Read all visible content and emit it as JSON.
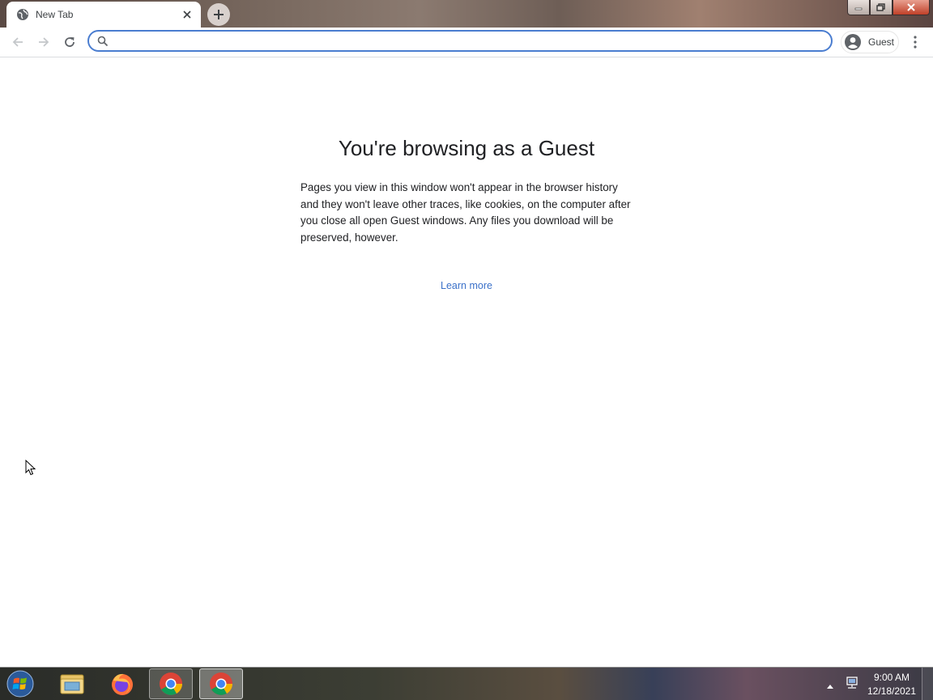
{
  "tab": {
    "title": "New Tab",
    "favicon": "globe-icon"
  },
  "toolbar": {
    "omnibox_value": "",
    "omnibox_placeholder": "",
    "profile_label": "Guest"
  },
  "content": {
    "heading": "You're browsing as a Guest",
    "paragraph": "Pages you view in this window won't appear in the browser history and they won't leave other traces, like cookies, on the computer after you close all open Guest windows. Any files you download will be preserved, however.",
    "learn_more": "Learn more",
    "link_color": "#3b71c9"
  },
  "taskbar": {
    "apps": [
      "windows-explorer-icon",
      "firefox-icon",
      "chrome-icon",
      "chrome-icon"
    ],
    "time": "9:00 AM",
    "date": "12/18/2021"
  },
  "colors": {
    "omnibox_focus": "#4a7dd0",
    "text": "#202124"
  }
}
